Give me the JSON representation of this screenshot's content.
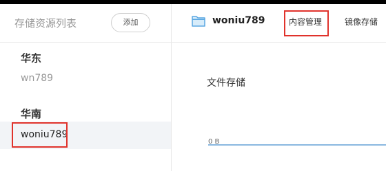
{
  "sidebar": {
    "title": "存储资源列表",
    "add_label": "添加",
    "regions": [
      {
        "name": "华东",
        "buckets": [
          "wn789"
        ]
      },
      {
        "name": "华南",
        "buckets": [
          "woniu789"
        ]
      }
    ],
    "selected_bucket": "woniu789"
  },
  "header": {
    "bucket_name": "woniu789",
    "bucket_icon": "folder-icon",
    "tabs": [
      {
        "label": "内容管理",
        "highlighted": true
      },
      {
        "label": "镜像存储",
        "highlighted": false
      }
    ]
  },
  "main": {
    "section_title": "文件存储",
    "chart": {
      "y_label": "0 B"
    }
  },
  "colors": {
    "highlight": "#e0322b",
    "chart_line": "#8ab8e0",
    "selected_bg": "#f2f4f7"
  }
}
